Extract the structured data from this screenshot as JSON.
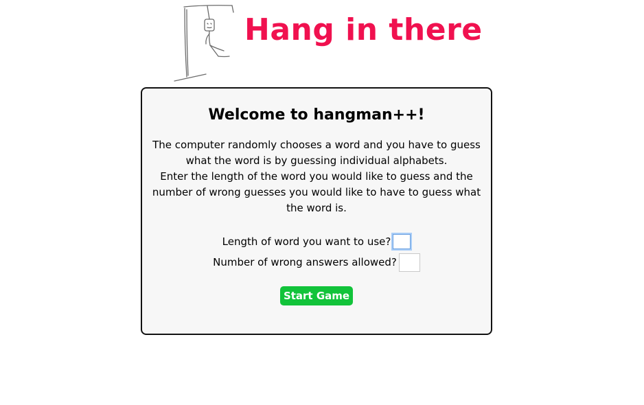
{
  "header": {
    "title": "Hang in there",
    "logo_icon": "hangman-sketch-icon",
    "title_color": "#f0114f"
  },
  "card": {
    "heading": "Welcome to hangman++!",
    "description_lines": [
      "The computer randomly chooses a word and you have to guess what the word is by guessing individual alphabets.",
      "Enter the length of the word you would like to guess and the number of wrong guesses you would like to have to guess what the word is."
    ],
    "form": {
      "length_label": "Length of word you want to use?",
      "length_value": "",
      "wrong_label": "Number of wrong answers allowed?",
      "wrong_value": ""
    },
    "start_button": "Start Game",
    "button_color": "#12c33a"
  }
}
